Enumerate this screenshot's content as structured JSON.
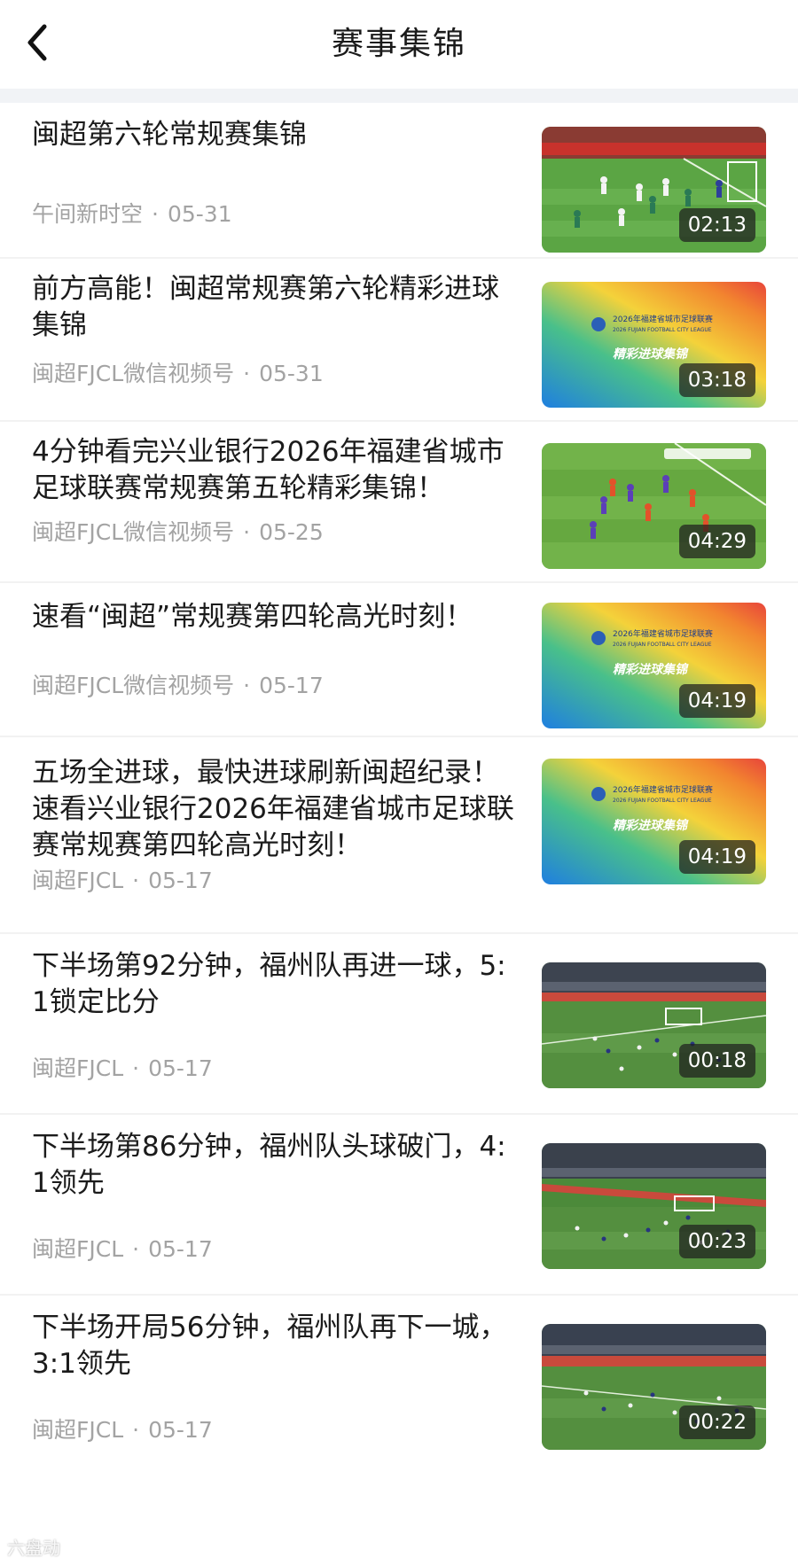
{
  "header": {
    "title": "赛事集锦"
  },
  "items": [
    {
      "title": "闽超第六轮常规赛集锦",
      "source": "午间新时空",
      "date": "05-31",
      "duration": "02:13",
      "thumb": "match-photo"
    },
    {
      "title": "前方高能！闽超常规赛第六轮精彩进球集锦",
      "source": "闽超FJCL微信视频号",
      "date": "05-31",
      "duration": "03:18",
      "thumb": "gradient-poster"
    },
    {
      "title": "4分钟看完兴业银行2026年福建省城市足球联赛常规赛第五轮精彩集锦！",
      "source": "闽超FJCL微信视频号",
      "date": "05-25",
      "duration": "04:29",
      "thumb": "match-photo"
    },
    {
      "title": "速看“闽超”常规赛第四轮高光时刻！",
      "source": "闽超FJCL微信视频号",
      "date": "05-17",
      "duration": "04:19",
      "thumb": "gradient-poster"
    },
    {
      "title": "五场全进球，最快进球刷新闽超纪录！速看兴业银行2026年福建省城市足球联赛常规赛第四轮高光时刻！",
      "source": "闽超FJCL",
      "date": "05-17",
      "duration": "04:19",
      "thumb": "gradient-poster"
    },
    {
      "title": "下半场第92分钟，福州队再进一球，5:1锁定比分",
      "source": "闽超FJCL",
      "date": "05-17",
      "duration": "00:18",
      "thumb": "stadium-photo"
    },
    {
      "title": "下半场第86分钟，福州队头球破门，4:1领先",
      "source": "闽超FJCL",
      "date": "05-17",
      "duration": "00:23",
      "thumb": "stadium-photo"
    },
    {
      "title": "下半场开局56分钟，福州队再下一城，3:1领先",
      "source": "闽超FJCL",
      "date": "05-17",
      "duration": "00:22",
      "thumb": "stadium-photo"
    }
  ],
  "poster": {
    "heading": "2026年福建省城市足球联赛",
    "subheading": "2026 FUJIAN FOOTBALL CITY LEAGUE",
    "slogan": "精彩进球集锦"
  },
  "watermark": "六盘动",
  "icons": {
    "back": "chevron-left-icon"
  },
  "colors": {
    "meta": "#a3a3a3",
    "divider": "#f2f2f2",
    "gap": "#f1f3f6"
  }
}
